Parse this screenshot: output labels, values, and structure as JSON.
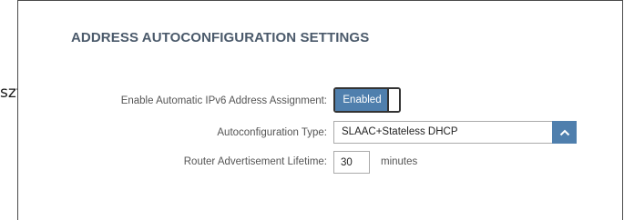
{
  "outside_label": "sztja:",
  "section": {
    "title": "ADDRESS AUTOCONFIGURATION SETTINGS"
  },
  "fields": {
    "enable_auto": {
      "label": "Enable Automatic IPv6 Address Assignment:",
      "state": "Enabled"
    },
    "autoconfig_type": {
      "label": "Autoconfiguration Type:",
      "selected": "SLAAC+Stateless DHCP",
      "icon": "chevron-up-icon"
    },
    "ra_lifetime": {
      "label": "Router Advertisement Lifetime:",
      "value": "30",
      "unit": "minutes"
    }
  },
  "colors": {
    "accent": "#4f7fad",
    "title": "#4b5a6b",
    "label": "#555555"
  }
}
